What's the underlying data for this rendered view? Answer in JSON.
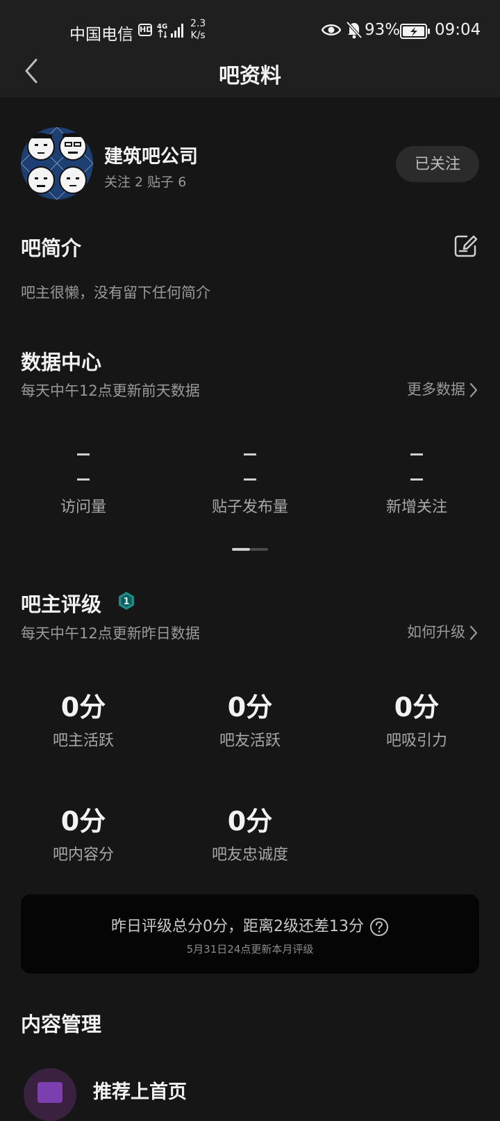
{
  "status_bar": {
    "carrier": "中国电信",
    "hd": "HD",
    "network": "4G",
    "speed_value": "2.3",
    "speed_unit": "K/s",
    "battery": "93%",
    "time": "09:04"
  },
  "header": {
    "title": "吧资料"
  },
  "forum": {
    "name": "建筑吧公司",
    "stats": "关注 2  贴子 6",
    "follow_label": "已关注"
  },
  "intro": {
    "title": "吧简介",
    "text": "吧主很懒，没有留下任何简介"
  },
  "data_center": {
    "title": "数据中心",
    "subtitle": "每天中午12点更新前天数据",
    "more_label": "更多数据",
    "stats": [
      {
        "label": "访问量"
      },
      {
        "label": "贴子发布量"
      },
      {
        "label": "新增关注"
      }
    ]
  },
  "rating": {
    "title": "吧主评级",
    "level": "1",
    "subtitle": "每天中午12点更新昨日数据",
    "more_label": "如何升级",
    "scores": [
      {
        "value": "0分",
        "label": "吧主活跃"
      },
      {
        "value": "0分",
        "label": "吧友活跃"
      },
      {
        "value": "0分",
        "label": "吧吸引力"
      },
      {
        "value": "0分",
        "label": "吧内容分"
      },
      {
        "value": "0分",
        "label": "吧友忠诚度"
      }
    ],
    "summary": "昨日评级总分0分，距离2级还差13分",
    "summary_note": "5月31日24点更新本月评级"
  },
  "content_management": {
    "title": "内容管理",
    "first_item": "推荐上首页"
  },
  "colors": {
    "background": "#161616",
    "card": "#050505",
    "badge": "#1f8a86"
  }
}
